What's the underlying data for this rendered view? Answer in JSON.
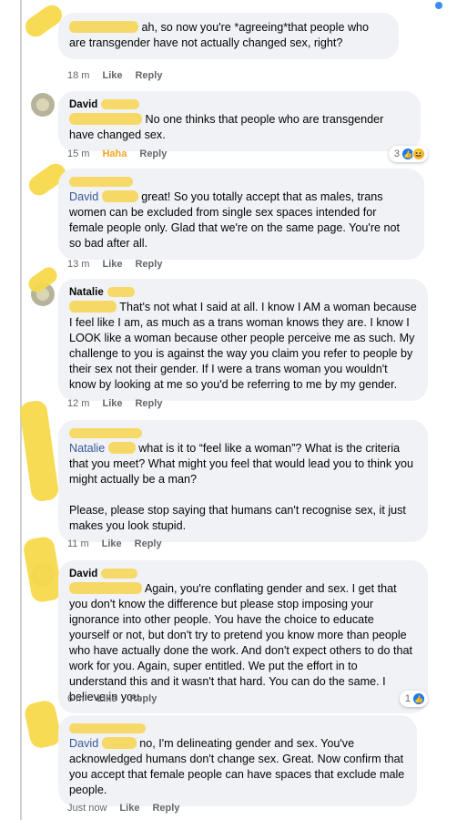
{
  "comments": [
    {
      "author": "",
      "mention": "",
      "text_after_mention": "ah, so now you're *agreeing*that people who are transgender have not actually changed sex, right?",
      "time": "18 m",
      "like": "Like",
      "reply": "Reply"
    },
    {
      "author": "David",
      "mention": "",
      "text_after_mention": "No one thinks that people who are transgender have changed sex.",
      "time": "15 m",
      "reaction_label": "Haha",
      "reply": "Reply",
      "reaction_count": "3",
      "reaction_icons": [
        "like-icon",
        "haha-icon"
      ]
    },
    {
      "author": "",
      "mention": "David",
      "text_after_mention": "great! So you totally accept that as males, trans women can be excluded from single sex spaces intended for female people only. Glad that we're on the same page. You're not so bad after all.",
      "time": "13 m",
      "like": "Like",
      "reply": "Reply"
    },
    {
      "author": "Natalie",
      "mention": "",
      "text_after_mention": "That's not what I said at all. I know I AM a woman because I feel like I am, as much as a trans woman knows they are. I know I LOOK like a woman because other people perceive me as such. My challenge to you is against the way you claim you refer to people by their sex not their gender. If I were a trans woman you wouldn't know by looking at me so you'd be referring to me by my gender.",
      "time": "12 m",
      "like": "Like",
      "reply": "Reply"
    },
    {
      "author": "",
      "mention": "Natalie",
      "text_after_mention": "what is it to “feel like a woman”? What is the criteria that you meet? What might you feel that would lead you to think you might actually be a man?",
      "text_para2": "Please, please stop saying that humans can't recognise sex, it just makes you look stupid.",
      "time": "11 m",
      "like": "Like",
      "reply": "Reply"
    },
    {
      "author": "David",
      "mention": "",
      "text_after_mention": "Again, you're conflating gender and sex. I get that you don't know the difference but please stop imposing your ignorance into other people. You have the choice to educate yourself or not, but don't try to pretend you know more than people who have actually done the work. And don't expect others to do that work for you. Again, super entitled. We put the effort in to understand this and it wasn't that hard. You can do the same. I believe in you.",
      "time": "6 m",
      "like": "Like",
      "reply": "Reply",
      "reaction_count": "1",
      "reaction_icons": [
        "like-icon"
      ]
    },
    {
      "author": "",
      "mention": "David",
      "text_after_mention": "no, I'm delineating gender and sex. You've acknowledged humans don't change sex. Great. Now confirm that you accept that female people can have spaces that exclude male people.",
      "time": "Just now",
      "like": "Like",
      "reply": "Reply"
    }
  ],
  "colors": {
    "bubble": "#f0f2f5",
    "mention": "#385898",
    "meta": "#65676b",
    "highlight": "#f6d659",
    "haha": "#f5a623",
    "like": "#1877f2"
  }
}
